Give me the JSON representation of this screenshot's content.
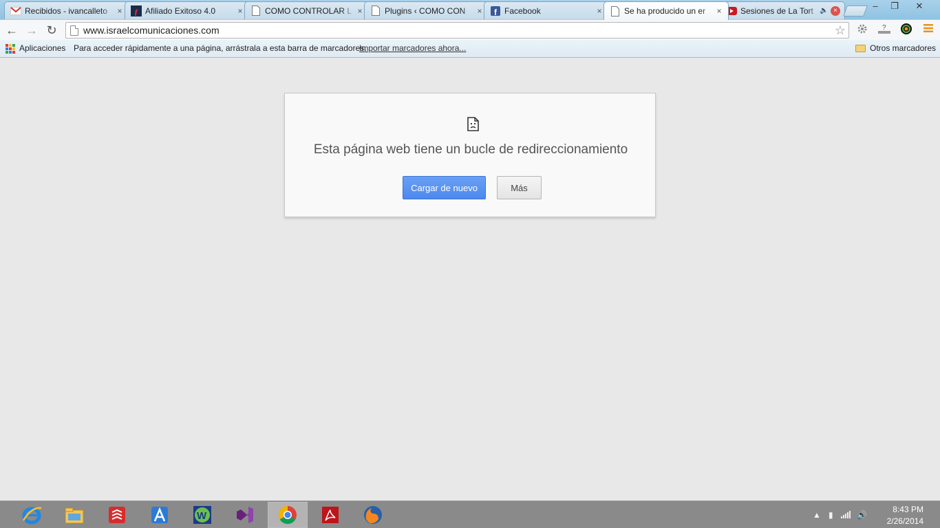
{
  "tabs": [
    {
      "title": "Recibidos - ivancalleto",
      "favicon": "gmail-icon",
      "active": false
    },
    {
      "title": "Afiliado Exitoso 4.0",
      "favicon": "afiliado-icon",
      "active": false
    },
    {
      "title": "COMO CONTROLAR L",
      "favicon": "page-icon",
      "active": false
    },
    {
      "title": "Plugins ‹ COMO CON",
      "favicon": "page-icon",
      "active": false
    },
    {
      "title": "Facebook",
      "favicon": "facebook-icon",
      "active": false
    },
    {
      "title": "Se ha producido un er",
      "favicon": "page-icon",
      "active": true
    },
    {
      "title": "Sesiones de La Tort",
      "favicon": "youtube-icon",
      "active": false
    }
  ],
  "window_controls": {
    "minimize": "–",
    "restore": "❐",
    "close": "✕"
  },
  "toolbar": {
    "back": "←",
    "forward": "→",
    "reload": "↻",
    "url": "www.israelcomunicaciones.com",
    "star": "☆"
  },
  "bookmarks": {
    "apps_label": "Aplicaciones",
    "hint": "Para acceder rápidamente a una página, arrástrala a esta barra de marcadores.",
    "import_link": "Importar marcadores ahora...",
    "other_label": "Otros marcadores"
  },
  "error_page": {
    "heading": "Esta página web tiene un bucle de redireccionamiento",
    "reload_button": "Cargar de nuevo",
    "more_button": "Más"
  },
  "taskbar": {
    "apps": [
      "internet-explorer-icon",
      "file-explorer-icon",
      "todoist-icon",
      "arch-icon",
      "webstorm-icon",
      "visual-studio-icon",
      "chrome-icon",
      "acrobat-icon",
      "firefox-icon"
    ],
    "active_app": "chrome-icon",
    "clock_time": "8:43 PM",
    "clock_date": "2/26/2014"
  },
  "colors": {
    "primary_button": "#4c89ef",
    "content_background": "#e8e8e8",
    "taskbar": "#8a8a8a"
  }
}
